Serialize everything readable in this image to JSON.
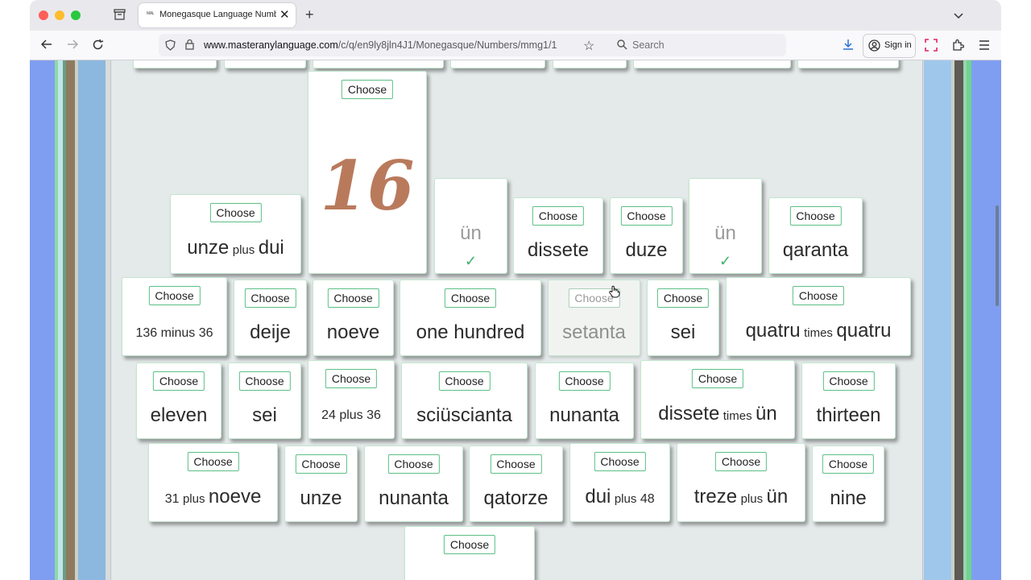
{
  "browser": {
    "tab_title": "Monegasque Language Number",
    "tab_favicon": "MAL",
    "url_domain": "www.masteranylanguage.com",
    "url_path": "/c/q/en9ly8jln4J1/Monegasque/Numbers/mmg1/1",
    "search_placeholder": "Search",
    "signin_label": "Sign in"
  },
  "game": {
    "choose_label": "Choose",
    "question_glyph": "16",
    "question_color": "#b97a5c",
    "answered_1": "ün",
    "answered_2": "ün",
    "check_mark": "✓",
    "cards": {
      "c_unze_dui": [
        "unze",
        "plus",
        "dui"
      ],
      "c_dissete": "dissete",
      "c_duze": "duze",
      "c_qaranta": "qaranta",
      "c_136_36": [
        "136",
        "minus",
        "36"
      ],
      "c_deije": "deije",
      "c_noeve": "noeve",
      "c_onehundred": "one hundred",
      "c_setanta": "setanta",
      "c_sei": "sei",
      "c_quatru": [
        "quatru",
        "times",
        "quatru"
      ],
      "c_eleven": "eleven",
      "c_sei2": "sei",
      "c_24_36": [
        "24",
        "plus",
        "36"
      ],
      "c_sciuscianta": "sciüscianta",
      "c_nunanta": "nunanta",
      "c_dissete_un": [
        "dissete",
        "times",
        "ün"
      ],
      "c_thirteen": "thirteen",
      "c_31_noeve": [
        "31",
        "plus",
        "noeve"
      ],
      "c_unze": "unze",
      "c_nunanta2": "nunanta",
      "c_qatorze": "qatorze",
      "c_dui_48": [
        "dui",
        "plus",
        "48"
      ],
      "c_treze_un": [
        "treze",
        "plus",
        "ün"
      ],
      "c_nine": "nine"
    }
  }
}
